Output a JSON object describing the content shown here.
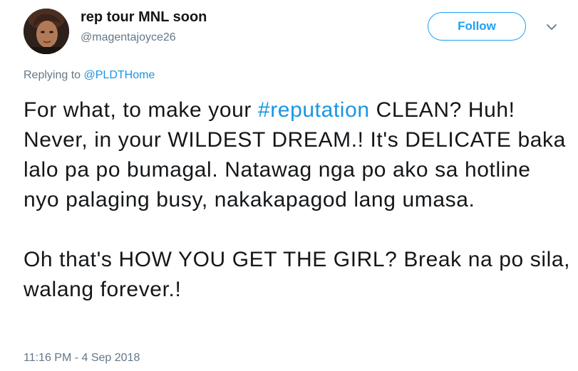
{
  "user": {
    "display_name": "rep tour MNL soon",
    "handle": "@magentajoyce26"
  },
  "follow_button": {
    "label": "Follow"
  },
  "reply_context": {
    "prefix": "Replying to ",
    "mention": "@PLDTHome"
  },
  "tweet": {
    "paragraph1": {
      "before": "For what, to make your ",
      "hashtag": "#reputation",
      "after": " CLEAN? Huh! Never, in your WILDEST DREAM.! It's DELICATE baka lalo pa po bumagal. Natawag nga po ako sa hotline nyo palaging busy, nakakapagod lang umasa."
    },
    "paragraph2": "Oh that's HOW YOU GET THE GIRL? Break na po sila, walang forever.!",
    "timestamp": "11:16 PM - 4 Sep 2018"
  },
  "colors": {
    "accent": "#1da1f2",
    "link": "#1b95e0",
    "secondary_text": "#657786",
    "primary_text": "#14171a"
  },
  "icons": {
    "menu": "chevron-down-icon",
    "avatar": "profile-photo"
  }
}
